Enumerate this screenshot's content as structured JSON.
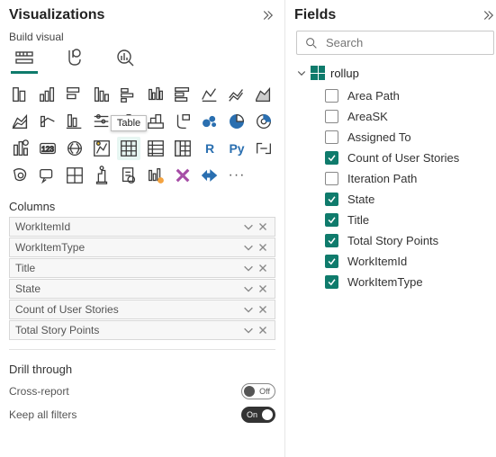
{
  "visualizations": {
    "title": "Visualizations",
    "subtitle": "Build visual",
    "tooltip": "Table",
    "columnsTitle": "Columns",
    "columns": [
      {
        "label": "WorkItemId"
      },
      {
        "label": "WorkItemType"
      },
      {
        "label": "Title"
      },
      {
        "label": "State"
      },
      {
        "label": "Count of User Stories"
      },
      {
        "label": "Total Story Points"
      }
    ],
    "drill": {
      "title": "Drill through",
      "crossReportLabel": "Cross-report",
      "crossReportState": "Off",
      "keepFiltersLabel": "Keep all filters",
      "keepFiltersState": "On"
    }
  },
  "fields": {
    "title": "Fields",
    "searchPlaceholder": "Search",
    "table": "rollup",
    "items": [
      {
        "label": "Area Path",
        "checked": false
      },
      {
        "label": "AreaSK",
        "checked": false
      },
      {
        "label": "Assigned To",
        "checked": false
      },
      {
        "label": "Count of User Stories",
        "checked": true
      },
      {
        "label": "Iteration Path",
        "checked": false
      },
      {
        "label": "State",
        "checked": true
      },
      {
        "label": "Title",
        "checked": true
      },
      {
        "label": "Total Story Points",
        "checked": true
      },
      {
        "label": "WorkItemId",
        "checked": true
      },
      {
        "label": "WorkItemType",
        "checked": true
      }
    ]
  }
}
